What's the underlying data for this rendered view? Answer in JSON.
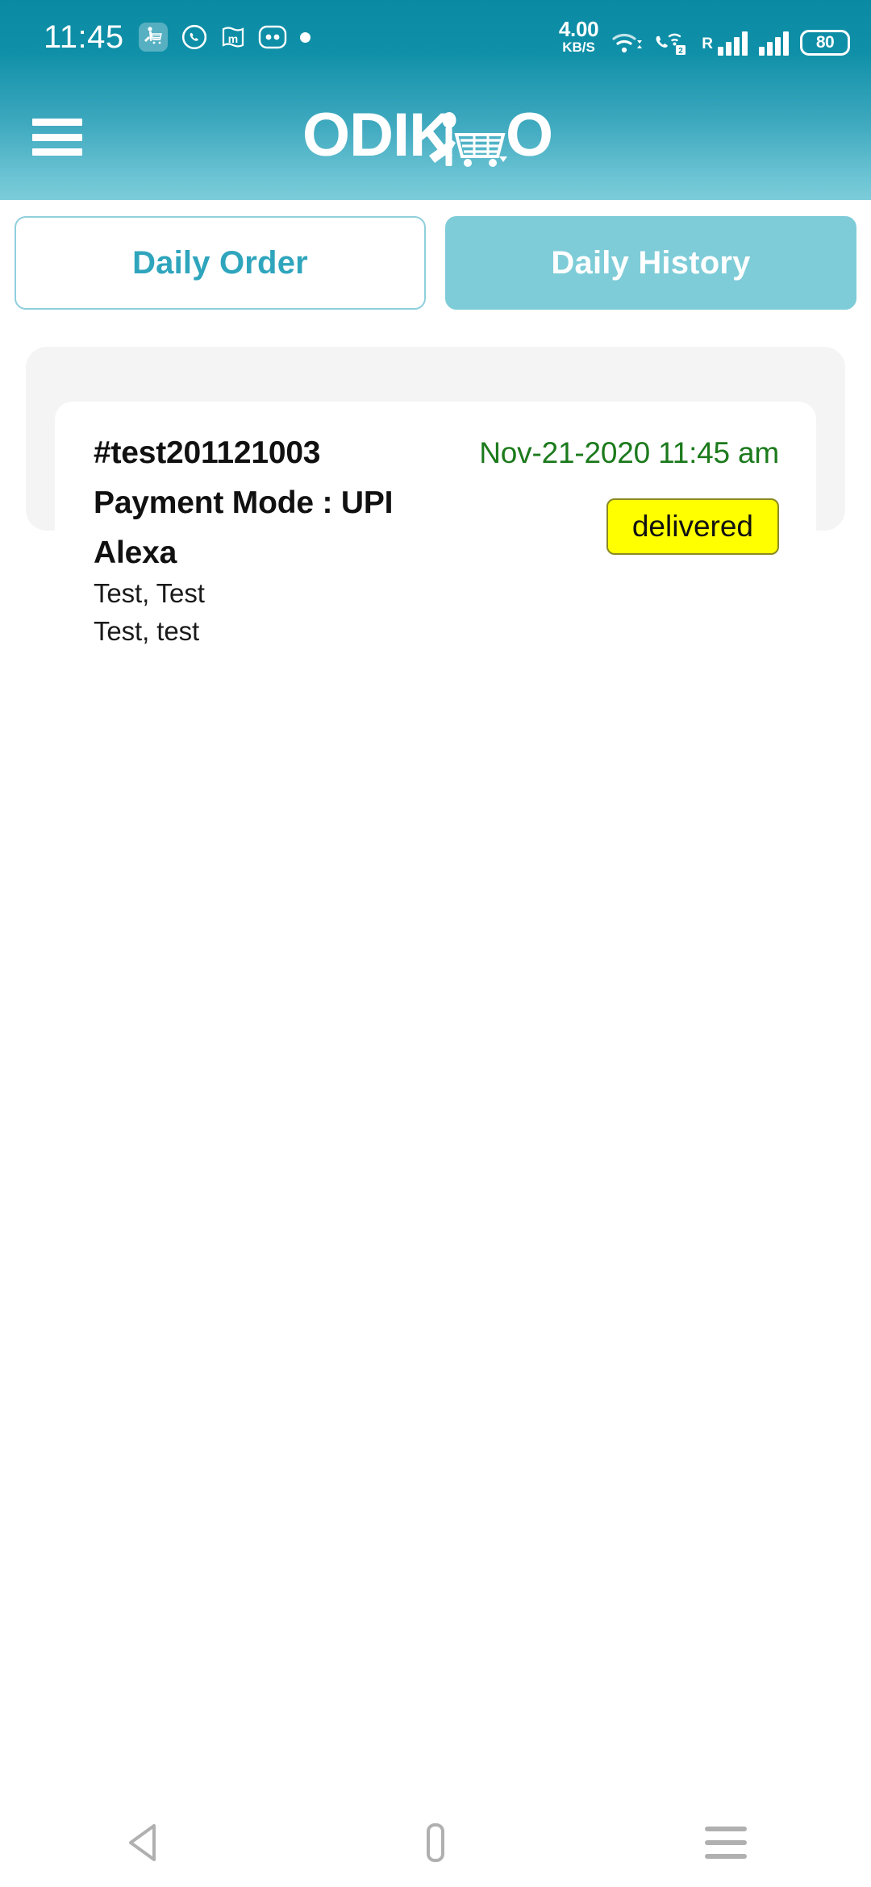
{
  "status_bar": {
    "clock": "11:45",
    "network_speed_value": "4.00",
    "network_speed_unit": "KB/S",
    "sim_badge": "2",
    "roaming_label": "R",
    "battery_level": "80",
    "notification_icons": [
      "odikio-app-icon",
      "whatsapp-icon",
      "m-app-icon",
      "two-dots-icon",
      "dot-icon"
    ],
    "right_icons": [
      "wifi-icon",
      "vowifi-call-icon",
      "signal-bars-icon",
      "signal-bars-icon",
      "battery-icon"
    ]
  },
  "app_bar": {
    "menu_icon": "hamburger-menu-icon",
    "brand_text_left": "ODIK",
    "brand_text_right": "O",
    "brand_full": "ODIKIO",
    "brand_mark": "shopper-with-cart-icon"
  },
  "tabs": [
    {
      "label": "Daily Order",
      "active": false
    },
    {
      "label": "Daily History",
      "active": true
    }
  ],
  "orders": [
    {
      "order_id": "#test201121003",
      "order_datetime": "Nov-21-2020 11:45 am",
      "payment_mode": "Payment Mode : UPI",
      "customer_name": "Alexa",
      "address_line_1": "Test, Test",
      "address_line_2": "Test, test",
      "status": "delivered"
    }
  ],
  "nav_bar": {
    "back_label": "back-button",
    "home_label": "home-button",
    "recents_label": "recents-button"
  },
  "colors": {
    "header_top": "#0b8aa3",
    "header_bottom": "#7cccd9",
    "tab_active_bg": "#7eccd8",
    "tab_inactive_text": "#2fa5bd",
    "date_green": "#1c7a1c",
    "status_yellow": "#ffff00",
    "card_shell_gray": "#f4f4f4"
  }
}
